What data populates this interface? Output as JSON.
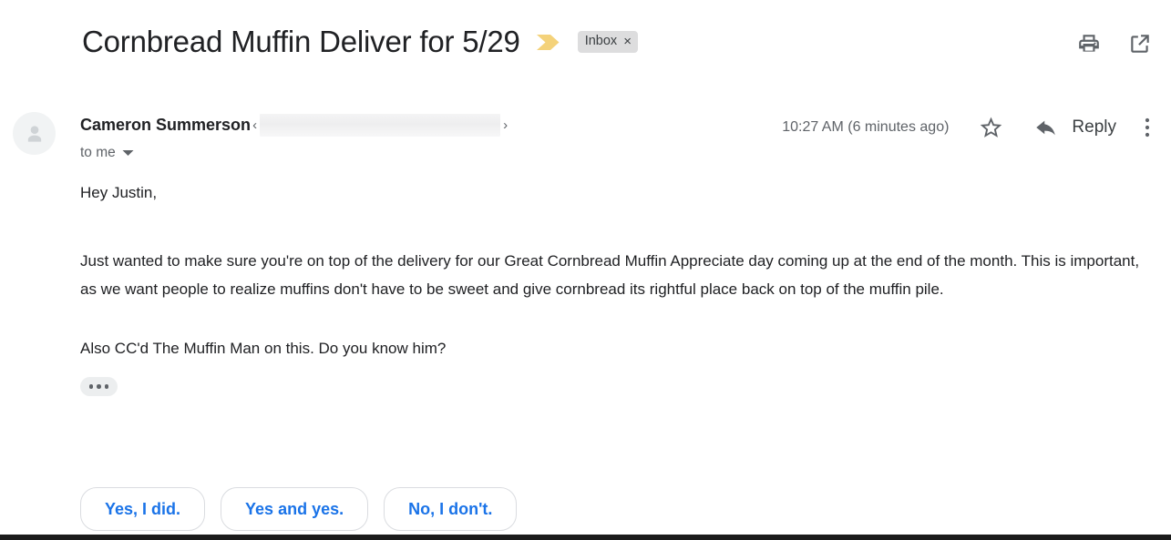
{
  "email": {
    "subject": "Cornbread Muffin Deliver for 5/29",
    "important_marker_icon": "important-chevron-icon",
    "important_marker_color": "#f4d27a",
    "label": {
      "name": "Inbox",
      "remove_glyph": "×"
    },
    "header_actions": [
      {
        "name": "print-button",
        "icon": "printer-icon"
      },
      {
        "name": "open-in-new-window-button",
        "icon": "external-link-icon"
      }
    ],
    "sender": {
      "avatar_icon": "person-avatar-icon",
      "name": "Cameron Summerson",
      "angle_open": "‹",
      "angle_close": "›",
      "address_redacted": true,
      "recipient": "to me",
      "recipient_caret_icon": "chevron-down-icon"
    },
    "timestamp": "10:27 AM (6 minutes ago)",
    "actions": {
      "star_icon": "star-outline-icon",
      "reply_icon": "reply-arrow-icon",
      "reply_label": "Reply",
      "more_icon": "more-vertical-icon"
    },
    "body": {
      "greeting": "Hey Justin,",
      "paragraph_1": "Just wanted to make sure you're on top of the delivery for our Great Cornbread Muffin Appreciate day coming up at the end of the month. This is important, as we want people to realize muffins don't have to be sweet and give cornbread its rightful place back on top of the muffin pile.",
      "paragraph_2": "Also CC'd The Muffin Man on this. Do you know him?",
      "trimmed_content_icon": "ellipsis-icon"
    },
    "smart_replies": [
      {
        "label": "Yes, I did."
      },
      {
        "label": "Yes and yes."
      },
      {
        "label": "No, I don't."
      }
    ],
    "colors": {
      "link_blue": "#1a73e8",
      "text_primary": "#202124",
      "text_secondary": "#5f6368",
      "chip_bg": "#ddddde",
      "border": "#dadce0"
    }
  }
}
